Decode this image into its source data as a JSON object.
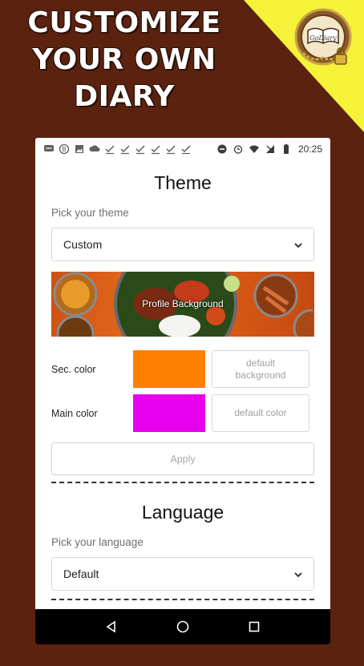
{
  "promo": {
    "line1": "CUSTOMIZE",
    "line2": "YOUR OWN",
    "line3": "DIARY",
    "logo_text": "GoDiary",
    "logo_icon": "diary-lock-logo"
  },
  "statusbar": {
    "time": "20:25",
    "left_icons": [
      "message-icon",
      "b-badge-icon",
      "image-icon",
      "cloud-icon",
      "check-icon",
      "check-icon",
      "check-icon",
      "check-icon",
      "check-icon",
      "check-icon"
    ],
    "right_icons": [
      "dnd-icon",
      "alarm-icon",
      "wifi-icon",
      "signal-icon",
      "battery-icon"
    ]
  },
  "theme": {
    "title": "Theme",
    "pick_label": "Pick your theme",
    "selected": "Custom",
    "banner_label": "Profile Background",
    "sec_color_label": "Sec. color",
    "sec_color_value": "#ff8000",
    "sec_default": "default background",
    "main_color_label": "Main color",
    "main_color_value": "#e600ee",
    "main_default": "default color",
    "apply": "Apply"
  },
  "language": {
    "title": "Language",
    "pick_label": "Pick your language",
    "selected": "Default"
  },
  "navbar": {
    "icons": [
      "back-icon",
      "home-icon",
      "recents-icon"
    ]
  },
  "colors": {
    "background": "#5a220f",
    "corner": "#f6f23a"
  }
}
